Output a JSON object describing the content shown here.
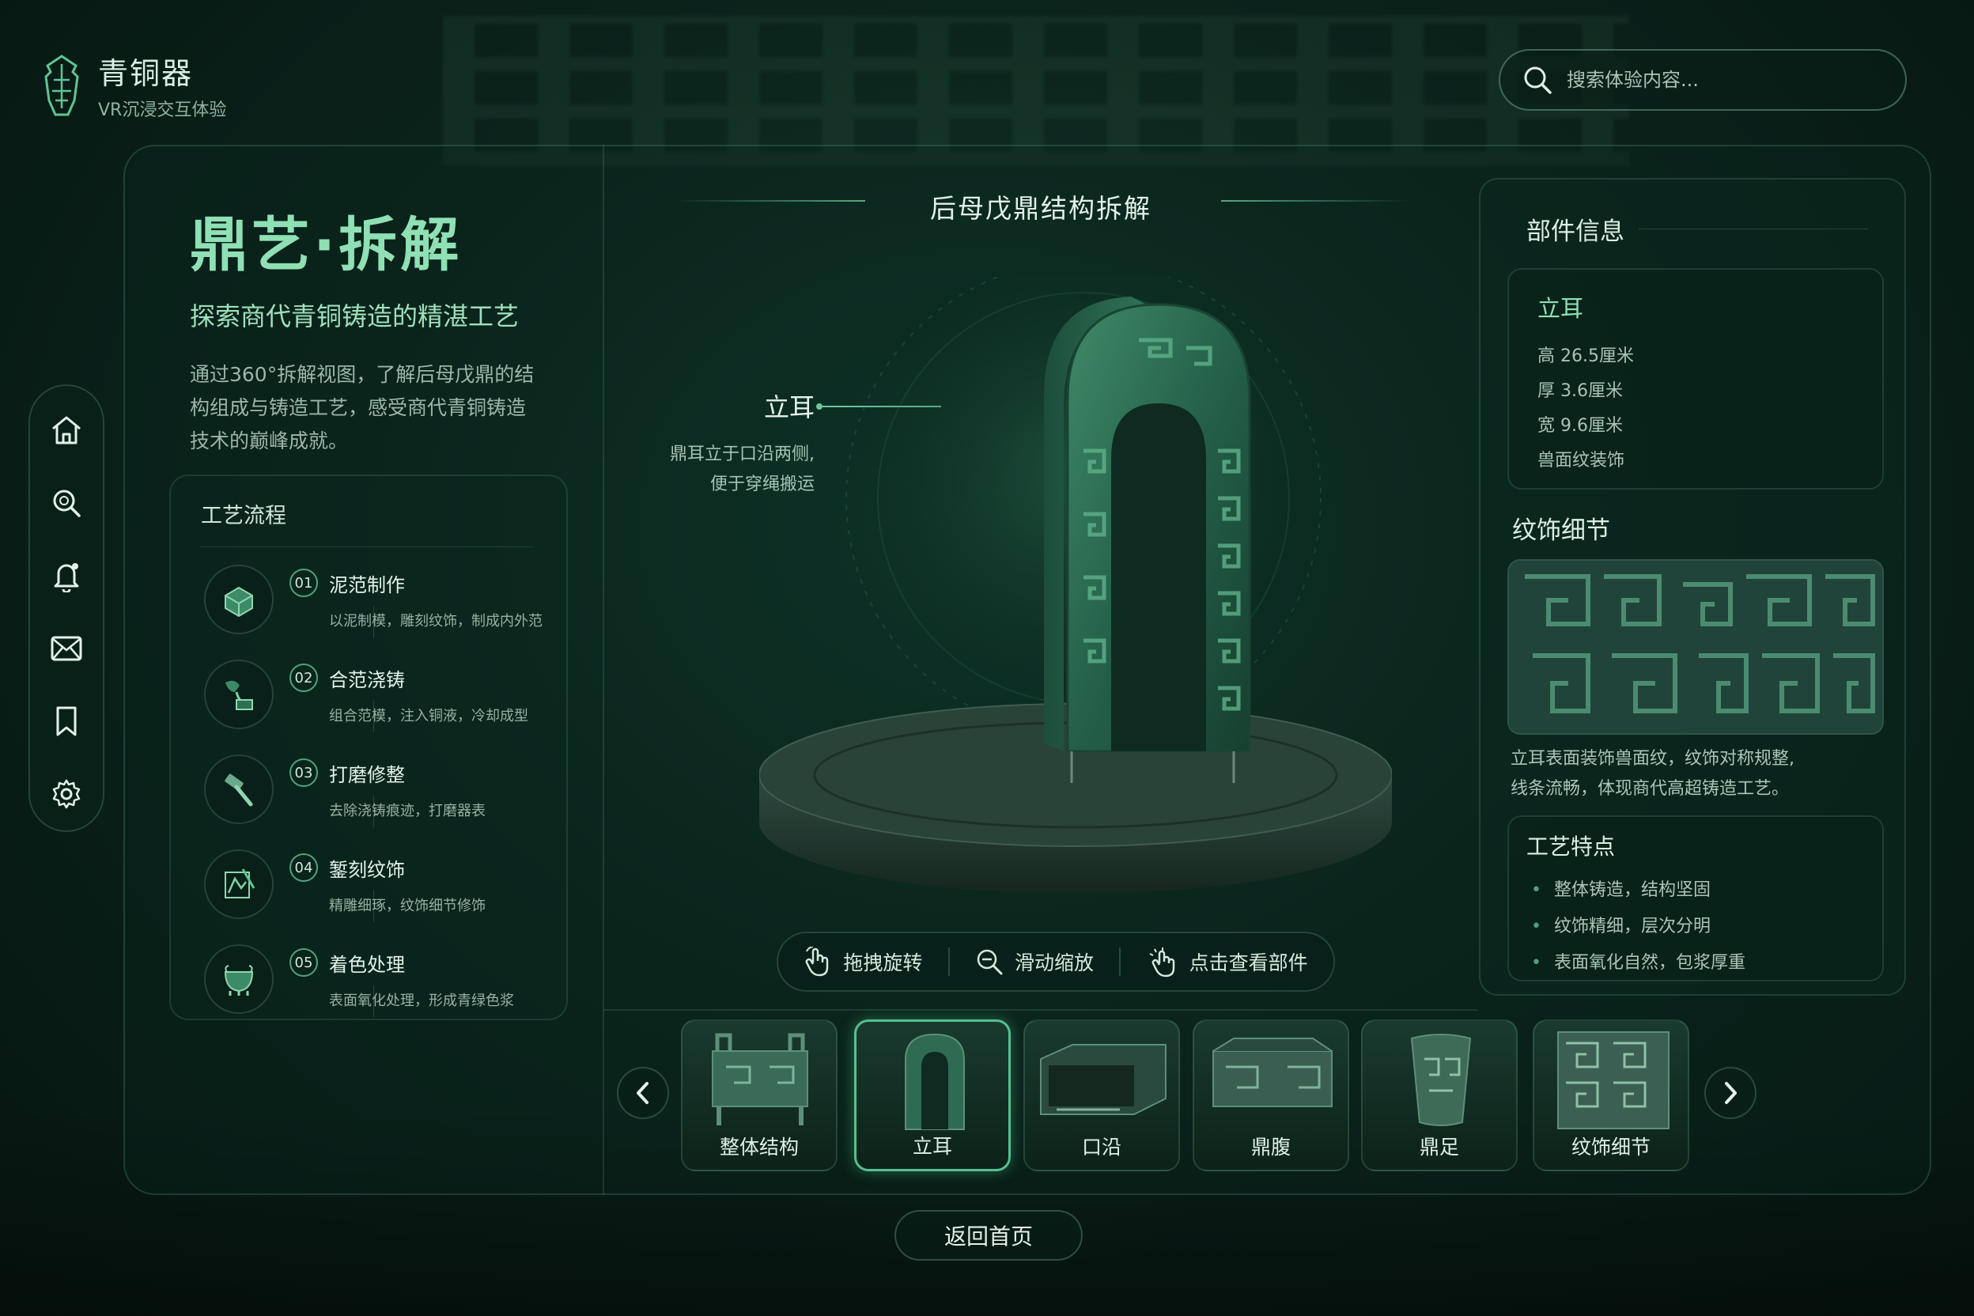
{
  "brand": {
    "title": "青铜器",
    "subtitle": "VR沉浸交互体验"
  },
  "search": {
    "placeholder": "搜索体验内容..."
  },
  "nav": [
    "home",
    "search",
    "notification",
    "mail",
    "bookmark",
    "settings"
  ],
  "intro": {
    "title": "鼎艺·拆解",
    "subtitle": "探索商代青铜铸造的精湛工艺",
    "description": "通过360°拆解视图，了解后母戊鼎的结构组成与铸造工艺，感受商代青铜铸造技术的巅峰成就。"
  },
  "process": {
    "title": "工艺流程",
    "steps": [
      {
        "num": "01",
        "name": "泥范制作",
        "desc": "以泥制模，雕刻纹饰，制成内外范",
        "icon": "mold-icon"
      },
      {
        "num": "02",
        "name": "合范浇铸",
        "desc": "组合范模，注入铜液，冷却成型",
        "icon": "pour-icon"
      },
      {
        "num": "03",
        "name": "打磨修整",
        "desc": "去除浇铸痕迹，打磨器表",
        "icon": "hammer-icon"
      },
      {
        "num": "04",
        "name": "錾刻纹饰",
        "desc": "精雕细琢，纹饰细节修饰",
        "icon": "carving-icon"
      },
      {
        "num": "05",
        "name": "着色处理",
        "desc": "表面氧化处理，形成青绿色浆",
        "icon": "cauldron-icon"
      }
    ]
  },
  "viewer": {
    "title": "后母戊鼎结构拆解",
    "part_name": "立耳",
    "part_desc_1": "鼎耳立于口沿两侧,",
    "part_desc_2": "便于穿绳搬运",
    "hints": [
      "拖拽旋转",
      "滑动缩放",
      "点击查看部件"
    ]
  },
  "thumbnails": [
    {
      "label": "整体结构",
      "active": false
    },
    {
      "label": "立耳",
      "active": true
    },
    {
      "label": "口沿",
      "active": false
    },
    {
      "label": "鼎腹",
      "active": false
    },
    {
      "label": "鼎足",
      "active": false
    },
    {
      "label": "纹饰细节",
      "active": false
    }
  ],
  "back_label": "返回首页",
  "info": {
    "title": "部件信息",
    "name": "立耳",
    "rows": [
      "高 26.5厘米",
      "厚 3.6厘米",
      "宽 9.6厘米",
      "兽面纹装饰"
    ]
  },
  "pattern": {
    "title": "纹饰细节",
    "text_1": "立耳表面装饰兽面纹，纹饰对称规整,",
    "text_2": "线条流畅，体现商代高超铸造工艺。"
  },
  "features": {
    "title": "工艺特点",
    "items": [
      "整体铸造，结构坚固",
      "纹饰精细，层次分明",
      "表面氧化自然，包浆厚重"
    ]
  },
  "colors": {
    "accent": "#55c08f",
    "title_green": "#8fe0b4",
    "bg": "#0b241c"
  }
}
